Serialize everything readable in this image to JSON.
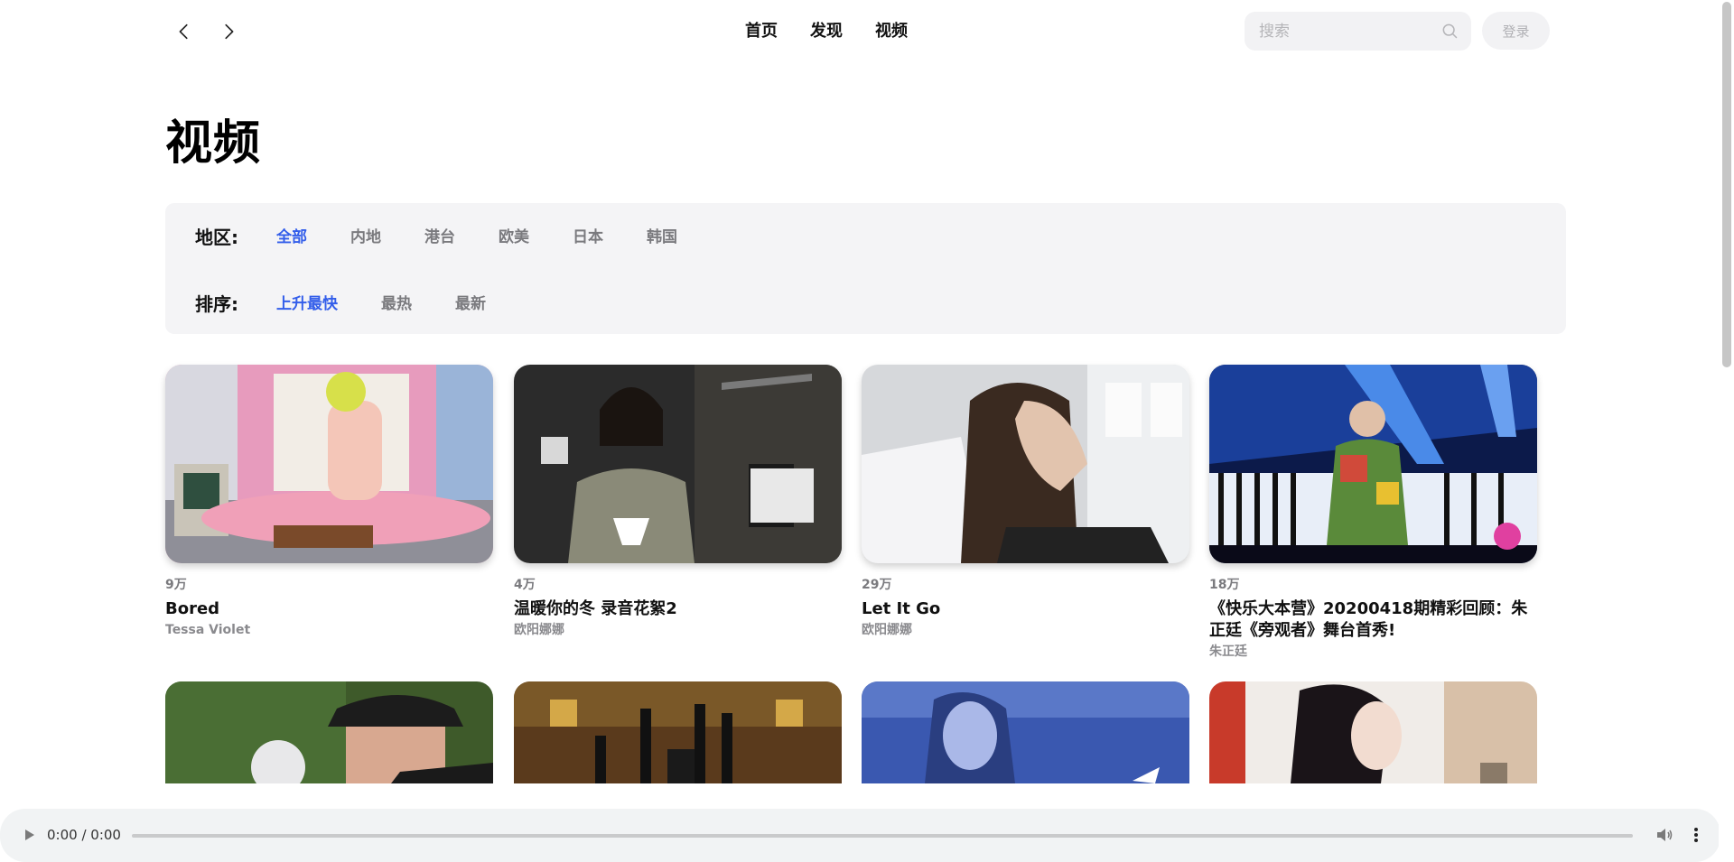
{
  "nav": {
    "back_icon": "chevron-left-icon",
    "forward_icon": "chevron-right-icon",
    "tabs": [
      {
        "label": "首页"
      },
      {
        "label": "发现"
      },
      {
        "label": "视频"
      }
    ],
    "search_placeholder": "搜索",
    "search_icon": "search-icon",
    "login_label": "登录"
  },
  "page": {
    "title": "视频"
  },
  "filters": {
    "region": {
      "label": "地区:",
      "options": [
        "全部",
        "内地",
        "港台",
        "欧美",
        "日本",
        "韩国"
      ],
      "selected": "全部"
    },
    "sort": {
      "label": "排序:",
      "options": [
        "上升最快",
        "最热",
        "最新"
      ],
      "selected": "上升最快"
    }
  },
  "videos": [
    {
      "count": "9万",
      "title": "Bored",
      "artist": "Tessa Violet"
    },
    {
      "count": "4万",
      "title": "温暖你的冬 录音花絮2",
      "artist": "欧阳娜娜"
    },
    {
      "count": "29万",
      "title": "Let It Go",
      "artist": "欧阳娜娜"
    },
    {
      "count": "18万",
      "title": "《快乐大本营》20200418期精彩回顾：朱正廷《旁观者》舞台首秀!",
      "artist": "朱正廷"
    }
  ],
  "player": {
    "time": "0:00 / 0:00",
    "play_icon": "play-icon",
    "volume_icon": "volume-icon",
    "more_icon": "more-vertical-icon"
  },
  "colors": {
    "accent": "#335eea",
    "panel_bg": "#f4f4f6",
    "muted_text": "#7a7a7e",
    "player_bg": "#f1f3f4"
  }
}
